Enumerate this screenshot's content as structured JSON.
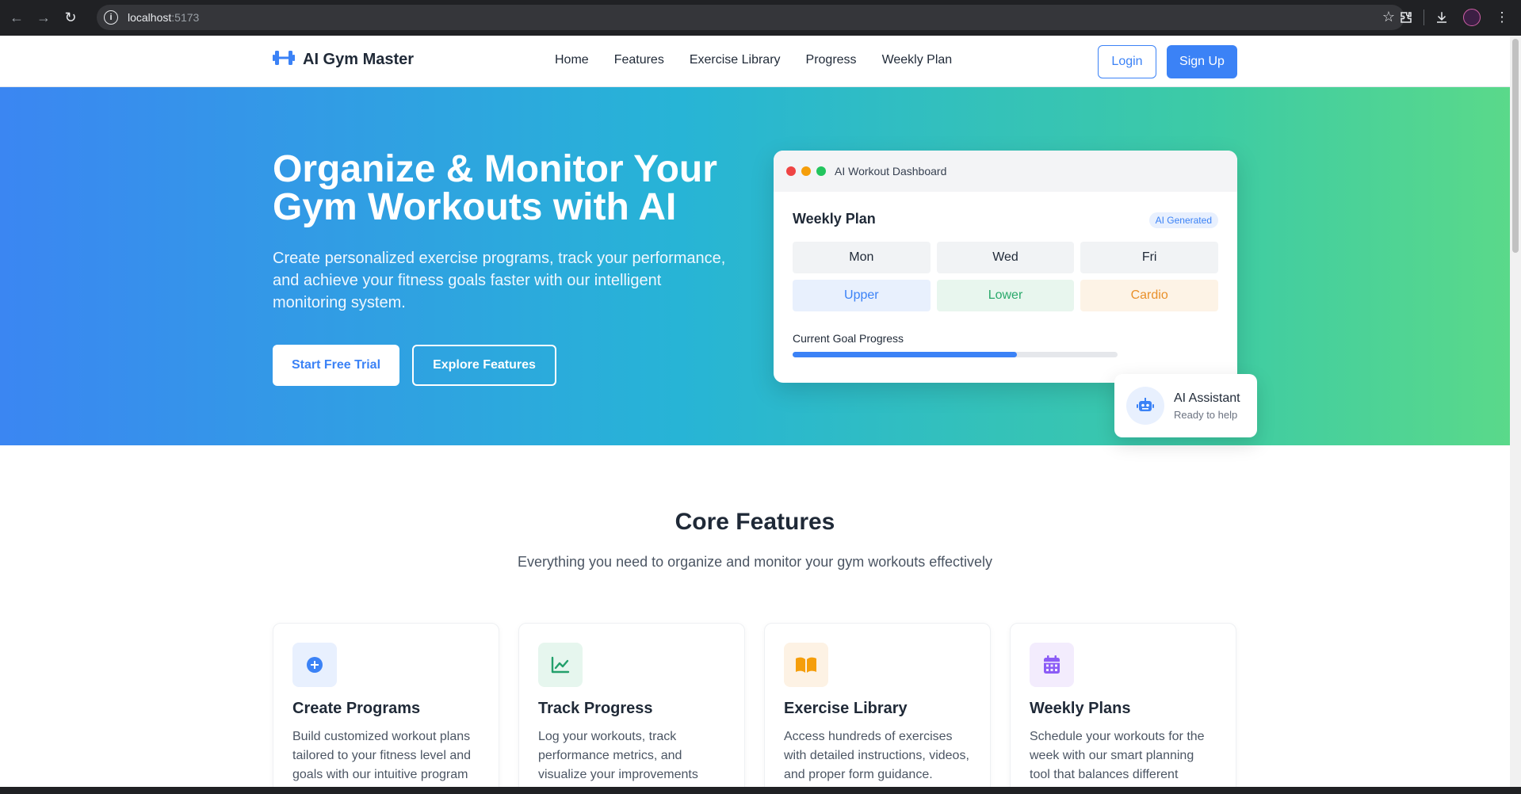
{
  "browser": {
    "url_host": "localhost",
    "url_port": ":5173"
  },
  "header": {
    "brand": "AI Gym Master",
    "nav": [
      "Home",
      "Features",
      "Exercise Library",
      "Progress",
      "Weekly Plan"
    ],
    "login_label": "Login",
    "signup_label": "Sign Up"
  },
  "hero": {
    "title": "Organize & Monitor Your Gym Workouts with AI",
    "subtitle": "Create personalized exercise programs, track your performance, and achieve your fitness goals faster with our intelligent monitoring system.",
    "primary_cta": "Start Free Trial",
    "secondary_cta": "Explore Features"
  },
  "dashboard": {
    "window_title": "AI Workout Dashboard",
    "section_title": "Weekly Plan",
    "badge": "AI Generated",
    "days": [
      "Mon",
      "Wed",
      "Fri"
    ],
    "workouts": [
      "Upper",
      "Lower",
      "Cardio"
    ],
    "goal_label": "Current Goal Progress",
    "goal_progress_fraction": 0.69
  },
  "assistant": {
    "name": "AI Assistant",
    "status": "Ready to help"
  },
  "features": {
    "title": "Core Features",
    "subtitle": "Everything you need to organize and monitor your gym workouts effectively",
    "cards": [
      {
        "title": "Create Programs",
        "desc": "Build customized workout plans tailored to your fitness level and goals with our intuitive program",
        "icon": "plus-circle-icon",
        "color": "#3b82f6",
        "bg": "#e8f0fe"
      },
      {
        "title": "Track Progress",
        "desc": "Log your workouts, track performance metrics, and visualize your improvements",
        "icon": "chart-line-icon",
        "color": "#22a06b",
        "bg": "#e6f6ee"
      },
      {
        "title": "Exercise Library",
        "desc": "Access hundreds of exercises with detailed instructions, videos, and proper form guidance.",
        "icon": "book-open-icon",
        "color": "#f59e0b",
        "bg": "#fdf2e4"
      },
      {
        "title": "Weekly Plans",
        "desc": "Schedule your workouts for the week with our smart planning tool that balances different",
        "icon": "calendar-icon",
        "color": "#8b5cf6",
        "bg": "#f3ecfd"
      }
    ]
  }
}
